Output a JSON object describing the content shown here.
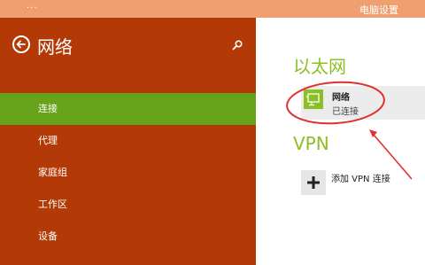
{
  "window": {
    "menu_glyph": "...",
    "title": "电脑设置"
  },
  "sidebar": {
    "title": "网络",
    "items": [
      {
        "label": "连接",
        "selected": true
      },
      {
        "label": "代理",
        "selected": false
      },
      {
        "label": "家庭组",
        "selected": false
      },
      {
        "label": "工作区",
        "selected": false
      },
      {
        "label": "设备",
        "selected": false
      }
    ]
  },
  "main": {
    "ethernet_header": "以太网",
    "network": {
      "name": "网络",
      "status": "已连接"
    },
    "vpn_header": "VPN",
    "add_vpn_label": "添加 VPN 连接"
  },
  "colors": {
    "titlebar": "#f0a070",
    "sidebar": "#b33a06",
    "selected_item": "#66a21a",
    "accent_green": "#8cbf26",
    "annotation": "#e03030"
  },
  "icons": [
    "back-icon",
    "search-icon",
    "network-monitor-icon",
    "plus-icon"
  ]
}
